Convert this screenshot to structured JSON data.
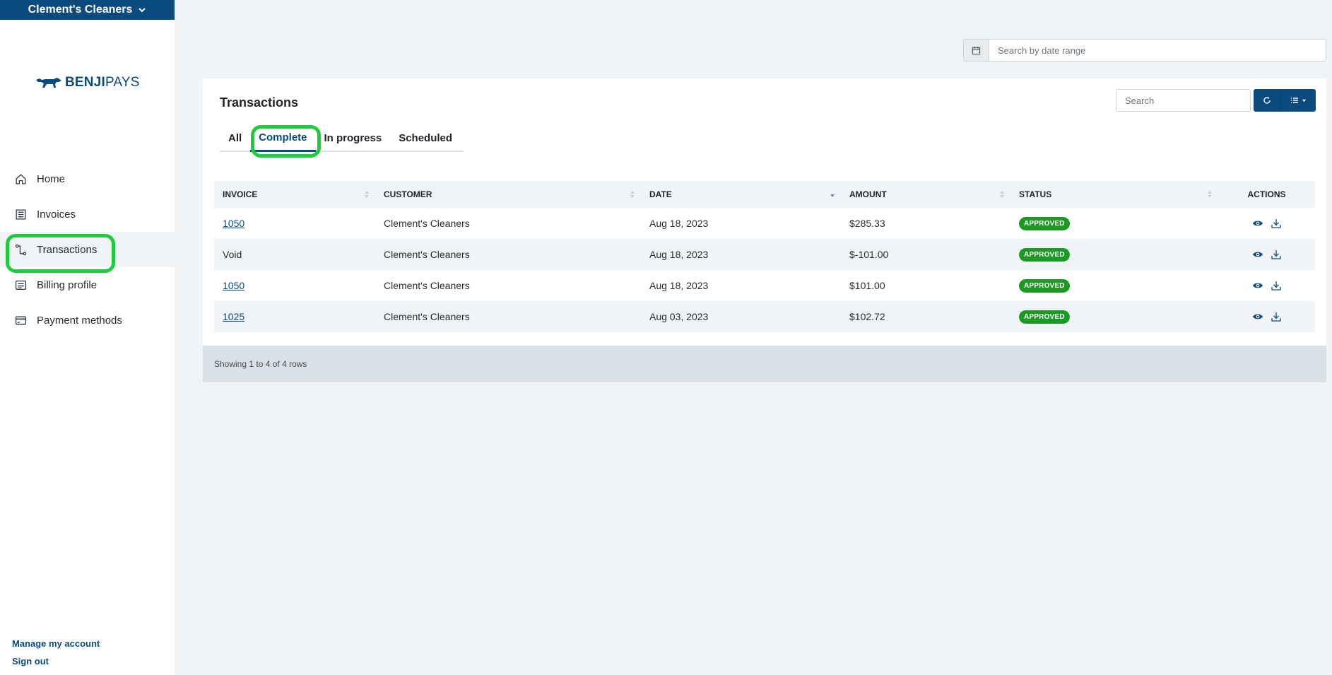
{
  "sidebar": {
    "company": "Clement's Cleaners",
    "logo": {
      "bold": "BENJI",
      "light": "PAYS"
    },
    "items": [
      {
        "label": "Home",
        "icon": "home-icon"
      },
      {
        "label": "Invoices",
        "icon": "invoice-icon"
      },
      {
        "label": "Transactions",
        "icon": "transactions-icon",
        "active": true
      },
      {
        "label": "Billing profile",
        "icon": "billing-profile-icon"
      },
      {
        "label": "Payment methods",
        "icon": "credit-card-icon"
      }
    ],
    "manage_account": "Manage my account",
    "sign_out": "Sign out"
  },
  "date_search": {
    "placeholder": "Search by date range"
  },
  "card": {
    "title": "Transactions",
    "tabs": [
      {
        "label": "All"
      },
      {
        "label": "Complete",
        "active": true
      },
      {
        "label": "In progress"
      },
      {
        "label": "Scheduled"
      }
    ],
    "search_placeholder": "Search",
    "columns": [
      "INVOICE",
      "CUSTOMER",
      "DATE",
      "AMOUNT",
      "STATUS",
      "ACTIONS"
    ],
    "rows": [
      {
        "invoice": "1050",
        "invoice_link": true,
        "customer": "Clement's Cleaners",
        "date": "Aug 18, 2023",
        "amount": "$285.33",
        "status": "APPROVED"
      },
      {
        "invoice": "Void",
        "invoice_link": false,
        "customer": "Clement's Cleaners",
        "date": "Aug 18, 2023",
        "amount": "$-101.00",
        "status": "APPROVED"
      },
      {
        "invoice": "1050",
        "invoice_link": true,
        "customer": "Clement's Cleaners",
        "date": "Aug 18, 2023",
        "amount": "$101.00",
        "status": "APPROVED"
      },
      {
        "invoice": "1025",
        "invoice_link": true,
        "customer": "Clement's Cleaners",
        "date": "Aug 03, 2023",
        "amount": "$102.72",
        "status": "APPROVED"
      }
    ],
    "footer": "Showing 1 to 4 of 4 rows"
  },
  "colors": {
    "brand": "#0b4a7d",
    "highlight": "#1fcc3e",
    "approved": "#1a9a23",
    "background": "#f1f4f7"
  }
}
